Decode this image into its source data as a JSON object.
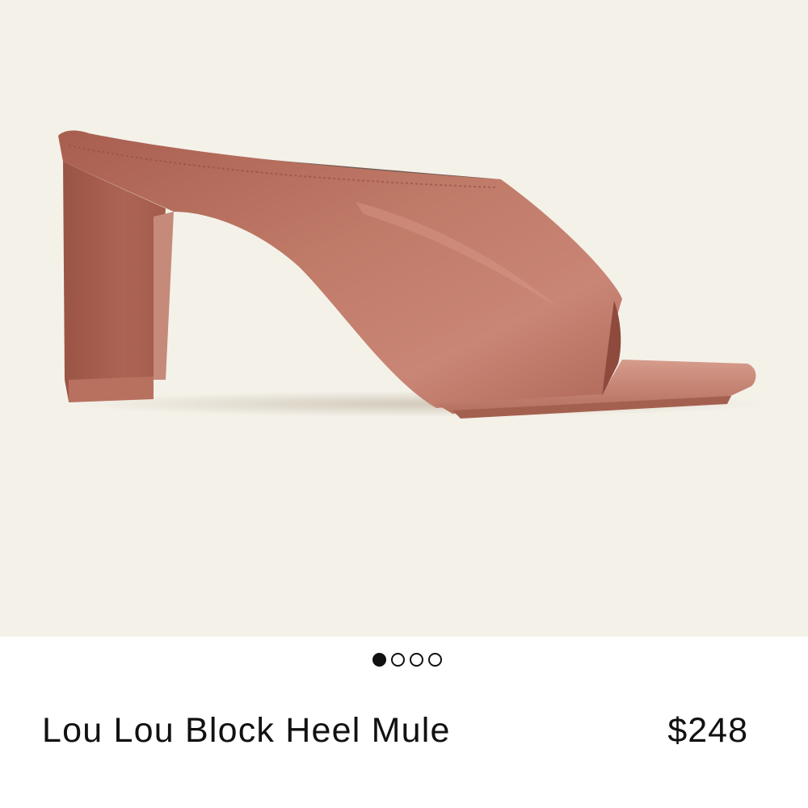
{
  "product": {
    "title": "Lou Lou Block Heel Mule",
    "price": "$248",
    "image_alt": "Brown leather square-toe block heel mule"
  },
  "carousel": {
    "total": 4,
    "active_index": 0
  },
  "colors": {
    "backdrop": "#f4f1e9",
    "leather": "#b86d5c",
    "text": "#111111"
  }
}
